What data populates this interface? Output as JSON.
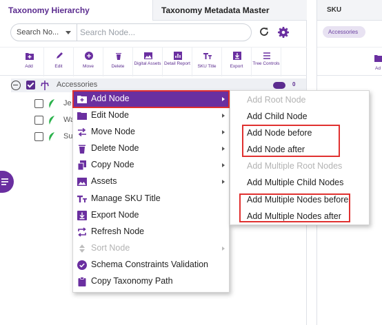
{
  "tabs": {
    "hierarchy": "Taxonomy Hierarchy",
    "metadata": "Taxonomy Metadata Master"
  },
  "search": {
    "filter_label": "Search No...",
    "placeholder": "Search Node..."
  },
  "toolbar": {
    "add": "Add",
    "edit": "Edit",
    "move": "Move",
    "delete": "Delete",
    "digital_assets": "Digital Assets",
    "detail_report": "Detail Report",
    "sku_title": "SKU Title",
    "export": "Export",
    "tree_controls": "Tree Controls"
  },
  "tree": {
    "root": {
      "label": "Accessories",
      "count": "0"
    },
    "children": [
      {
        "label": "Je"
      },
      {
        "label": "Wa"
      },
      {
        "label": "Su"
      }
    ]
  },
  "right_pane": {
    "tab": "SKU",
    "chip": "Accessories",
    "add_label": "Ad"
  },
  "context_menu": {
    "items": [
      {
        "label": "Add Node",
        "icon": "add-node-icon",
        "submenu": true,
        "state": "active"
      },
      {
        "label": "Edit Node",
        "icon": "folder-icon",
        "submenu": true,
        "state": "normal"
      },
      {
        "label": "Move Node",
        "icon": "move-arrows-icon",
        "submenu": true,
        "state": "normal"
      },
      {
        "label": "Delete Node",
        "icon": "trash-icon",
        "submenu": true,
        "state": "normal"
      },
      {
        "label": "Copy Node",
        "icon": "copy-icon",
        "submenu": true,
        "state": "normal"
      },
      {
        "label": "Assets",
        "icon": "image-icon",
        "submenu": true,
        "state": "normal"
      },
      {
        "label": "Manage SKU Title",
        "icon": "text-title-icon",
        "submenu": false,
        "state": "normal"
      },
      {
        "label": "Export Node",
        "icon": "export-icon",
        "submenu": false,
        "state": "normal"
      },
      {
        "label": "Refresh Node",
        "icon": "refresh-swap-icon",
        "submenu": false,
        "state": "normal"
      },
      {
        "label": "Sort Node",
        "icon": "sort-icon",
        "submenu": true,
        "state": "disabled"
      },
      {
        "label": "Schema Constraints Validation",
        "icon": "check-circle-icon",
        "submenu": false,
        "state": "normal"
      },
      {
        "label": "Copy Taxonomy Path",
        "icon": "clipboard-icon",
        "submenu": false,
        "state": "normal"
      }
    ]
  },
  "submenu": {
    "items": [
      {
        "label": "Add Root Node",
        "state": "disabled"
      },
      {
        "label": "Add Child Node",
        "state": "normal"
      },
      {
        "label": "Add Node before",
        "state": "normal"
      },
      {
        "label": "Add Node after",
        "state": "normal"
      },
      {
        "label": "Add Multiple Root Nodes",
        "state": "disabled"
      },
      {
        "label": "Add Multiple Child Nodes",
        "state": "normal"
      },
      {
        "label": "Add Multiple Nodes before",
        "state": "normal"
      },
      {
        "label": "Add Multiple Nodes after",
        "state": "normal"
      }
    ]
  },
  "colors": {
    "accent": "#6a2fa0",
    "highlight_box": "#e0302f",
    "leaf": "#2bb24c"
  }
}
